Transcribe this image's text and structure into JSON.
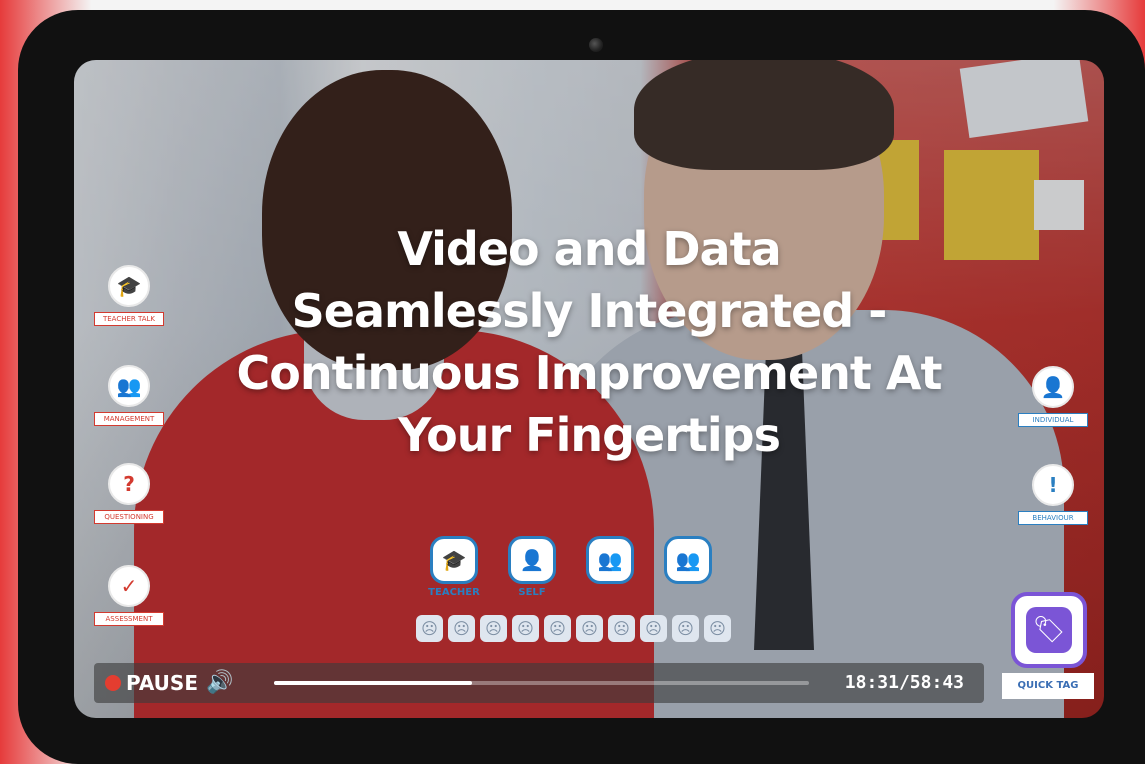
{
  "video": {
    "headline_lines": [
      "Video and Data",
      "Seamlessly Integrated -",
      "Continuous Improvement At",
      "Your Fingertips"
    ],
    "left_tags": [
      {
        "icon": "graduation-cap-icon",
        "glyph": "🎓",
        "label": "TEACHER TALK"
      },
      {
        "icon": "group-icon",
        "glyph": "👥",
        "label": "MANAGEMENT"
      },
      {
        "icon": "question-bubble-icon",
        "glyph": "?",
        "label": "QUESTIONING"
      },
      {
        "icon": "checkmark-icon",
        "glyph": "✓",
        "label": "ASSESSMENT"
      }
    ],
    "right_tags": [
      {
        "icon": "person-icon",
        "glyph": "👤",
        "label": "INDIVIDUAL"
      },
      {
        "icon": "exclamation-icon",
        "glyph": "!",
        "label": "BEHAVIOUR"
      }
    ],
    "center_tags": [
      {
        "icon": "graduation-cap-icon",
        "glyph": "🎓",
        "label": "TEACHER"
      },
      {
        "icon": "person-icon",
        "glyph": "👤",
        "label": "SELF"
      },
      {
        "icon": "group-icon",
        "glyph": "👥",
        "label": ""
      },
      {
        "icon": "group-icon",
        "glyph": "👥",
        "label": ""
      }
    ],
    "rating_faces_count": 10,
    "controls": {
      "pause_label": "PAUSE",
      "timecode": "18:31/58:43",
      "progress": 0.37
    },
    "quick_tag_label": "QUICK TAG",
    "colors": {
      "teacher_red": "#d33a2f",
      "student_blue": "#2a7fc1",
      "quick_tag_purple": "#7b55d6"
    }
  }
}
